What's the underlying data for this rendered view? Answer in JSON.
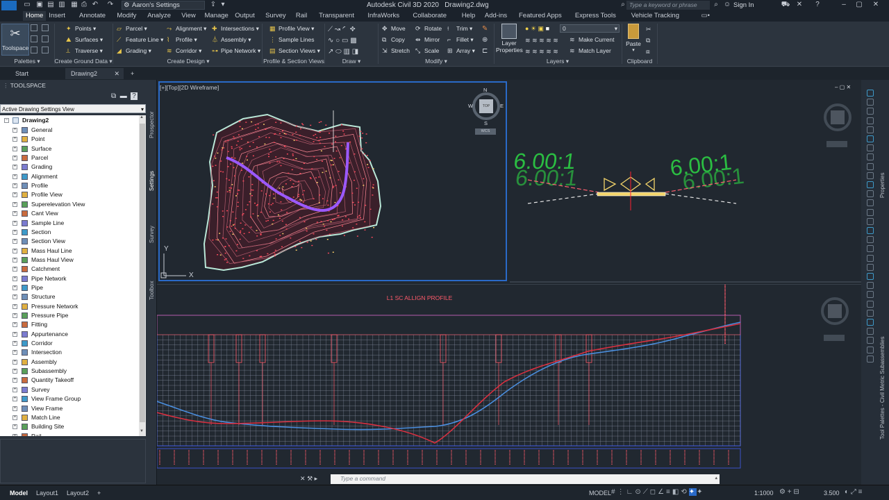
{
  "title_bar": {
    "app_title": "Autodesk Civil 3D 2020",
    "file_name": "Drawing2.dwg",
    "workspace": "Aaron's Settings",
    "search_placeholder": "Type a keyword or phrase",
    "sign_in": "Sign In"
  },
  "ribbon_tabs": [
    "Home",
    "Insert",
    "Annotate",
    "Modify",
    "Analyze",
    "View",
    "Manage",
    "Output",
    "Survey",
    "Rail",
    "Transparent",
    "InfraWorks",
    "Collaborate",
    "Help",
    "Add-ins",
    "Featured Apps",
    "Express Tools",
    "Vehicle Tracking"
  ],
  "active_ribbon_tab": "Home",
  "ribbon": {
    "palettes": {
      "toolspace": "Toolspace",
      "title": "Palettes"
    },
    "create_ground_data": {
      "title": "Create Ground Data",
      "items": [
        "Points",
        "Surfaces",
        "Traverse"
      ]
    },
    "create_design": {
      "title": "Create Design",
      "col1": [
        "Parcel",
        "Feature Line",
        "Grading"
      ],
      "col2": [
        "Alignment",
        "Profile",
        "Corridor"
      ],
      "col3": [
        "Intersections",
        "Assembly",
        "Pipe Network"
      ]
    },
    "profile_section": {
      "title": "Profile & Section Views",
      "items": [
        "Profile View",
        "Sample Lines",
        "Section Views"
      ]
    },
    "draw": {
      "title": "Draw"
    },
    "modify": {
      "title": "Modify",
      "col1": [
        "Move",
        "Copy",
        "Stretch"
      ],
      "col2": [
        "Rotate",
        "Mirror",
        "Scale"
      ],
      "col3": [
        "Trim",
        "Fillet",
        "Array"
      ]
    },
    "layers": {
      "title": "Layers",
      "layer_properties": "Layer Properties",
      "current_layer": "0",
      "make_current": "Make Current",
      "match_layer": "Match Layer"
    },
    "clipboard": {
      "title": "Clipboard",
      "paste": "Paste"
    }
  },
  "file_tabs": [
    "Start",
    "Drawing2"
  ],
  "active_file_tab": "Drawing2",
  "toolspace": {
    "title": "TOOLSPACE",
    "view_selector": "Active Drawing Settings View",
    "root": "Drawing2",
    "items": [
      "General",
      "Point",
      "Surface",
      "Parcel",
      "Grading",
      "Alignment",
      "Profile",
      "Profile View",
      "Superelevation View",
      "Cant View",
      "Sample Line",
      "Section",
      "Section View",
      "Mass Haul Line",
      "Mass Haul View",
      "Catchment",
      "Pipe Network",
      "Pipe",
      "Structure",
      "Pressure Network",
      "Pressure Pipe",
      "Fitting",
      "Appurtenance",
      "Corridor",
      "Intersection",
      "Assembly",
      "Subassembly",
      "Quantity Takeoff",
      "Survey",
      "View Frame Group",
      "View Frame",
      "Match Line",
      "Building Site",
      "Rail"
    ],
    "side_tabs": [
      "Prospector",
      "Settings",
      "Survey",
      "Toolbox"
    ]
  },
  "viewport": {
    "top_left_label": "[+][Top][2D Wireframe]",
    "viewcube_top": "TOP",
    "compass": [
      "N",
      "E",
      "S",
      "W"
    ],
    "wcs": "WCS",
    "ucs_x": "X",
    "ucs_y": "Y"
  },
  "assembly_view": {
    "slope_left": "6.00:1",
    "slope_right": "6.00:1"
  },
  "profile_view": {
    "title": "L1 SC ALLIGN PROFILE"
  },
  "command_line": {
    "placeholder": "Type a command"
  },
  "right_palette": {
    "label": "Tool Palettes - Civil Metric Subassemblies",
    "properties": "Properties"
  },
  "status_bar": {
    "tabs": [
      "Model",
      "Layout1",
      "Layout2"
    ],
    "active_tab": "Model",
    "model_label": "MODEL",
    "scale": "1:1000",
    "value": "3.500"
  },
  "colors": {
    "background": "#212830",
    "ribbon": "#2c343e",
    "accent_blue": "#2a6ac8",
    "contour_red": "#ff5a6a",
    "alignment_purple": "#9b59ff",
    "profile_grid": "#c3c8d8",
    "assembly_green": "#2bbd42"
  }
}
